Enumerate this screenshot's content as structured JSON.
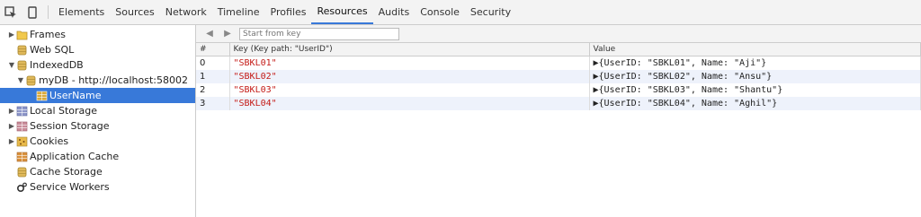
{
  "toolbar": {
    "tabs": [
      "Elements",
      "Sources",
      "Network",
      "Timeline",
      "Profiles",
      "Resources",
      "Audits",
      "Console",
      "Security"
    ],
    "active_tab": "Resources"
  },
  "sidebar": {
    "items": [
      {
        "label": "Frames"
      },
      {
        "label": "Web SQL"
      },
      {
        "label": "IndexedDB"
      },
      {
        "label": "myDB - http://localhost:58002"
      },
      {
        "label": "UserName"
      },
      {
        "label": "Local Storage"
      },
      {
        "label": "Session Storage"
      },
      {
        "label": "Cookies"
      },
      {
        "label": "Application Cache"
      },
      {
        "label": "Cache Storage"
      },
      {
        "label": "Service Workers"
      }
    ]
  },
  "key_search": {
    "placeholder": "Start from key"
  },
  "table": {
    "headers": [
      "#",
      "Key (Key path: \"UserID\")",
      "Value"
    ],
    "rows": [
      {
        "num": "0",
        "key": "\"SBKL01\"",
        "value": "▶{UserID: \"SBKL01\", Name: \"Aji\"}"
      },
      {
        "num": "1",
        "key": "\"SBKL02\"",
        "value": "▶{UserID: \"SBKL02\", Name: \"Ansu\"}"
      },
      {
        "num": "2",
        "key": "\"SBKL03\"",
        "value": "▶{UserID: \"SBKL03\", Name: \"Shantu\"}"
      },
      {
        "num": "3",
        "key": "\"SBKL04\"",
        "value": "▶{UserID: \"SBKL04\", Name: \"Aghil\"}"
      }
    ]
  },
  "colors": {
    "accent": "#3879d9",
    "key_string": "#c41a16"
  }
}
